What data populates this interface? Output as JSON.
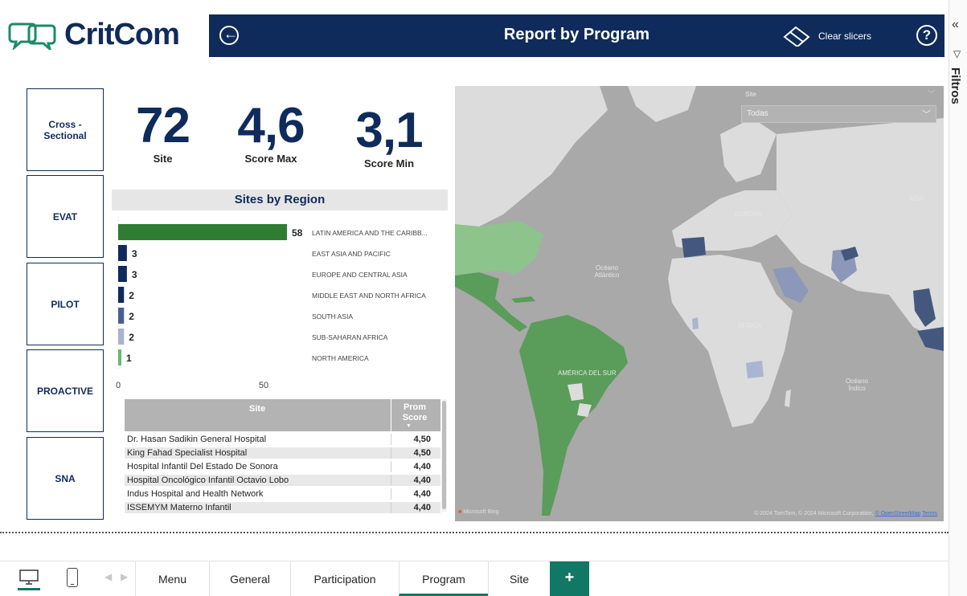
{
  "header": {
    "logo_text": "CritCom",
    "title": "Report by Program",
    "clear_slicers_label": "Clear slicers",
    "help_label": "?"
  },
  "filters_pane": {
    "label": "Filtros",
    "collapse_icon": "double-chevron-left-icon",
    "filter_icon": "funnel-icon"
  },
  "nav": {
    "buttons": [
      "Cross -\nSectional",
      "EVAT",
      "PILOT",
      "PROACTIVE",
      "SNA"
    ]
  },
  "kpis": [
    {
      "value": "72",
      "label": "Site"
    },
    {
      "value": "4,6",
      "label": "Score Max"
    },
    {
      "value": "3,1",
      "label": "Score Min"
    }
  ],
  "sites_by_region": {
    "title": "Sites by Region"
  },
  "chart_data": {
    "type": "bar",
    "orientation": "horizontal",
    "title": "Sites by Region",
    "categories": [
      "LATIN AMERICA AND THE CARIBB...",
      "EAST ASIA AND PACIFIC",
      "EUROPE AND CENTRAL ASIA",
      "MIDDLE EAST AND NORTH AFRICA",
      "SOUTH ASIA",
      "SUB-SAHARAN AFRICA",
      "NORTH AMERICA"
    ],
    "values": [
      58,
      3,
      3,
      2,
      2,
      2,
      1
    ],
    "colors": [
      "#2e7d32",
      "#0f2b5b",
      "#0f2b5b",
      "#0f2b5b",
      "#4b5f8f",
      "#a7b3cf",
      "#66bb6a"
    ],
    "xlim": [
      0,
      58
    ],
    "xticks": [
      "0",
      "50"
    ],
    "grid": false
  },
  "site_table": {
    "columns": [
      "Site",
      "Prom Score"
    ],
    "rows": [
      {
        "site": "Dr. Hasan Sadikin General Hospital",
        "score": "4,50"
      },
      {
        "site": "King Fahad Specialist Hospital",
        "score": "4,50"
      },
      {
        "site": "Hospital Infantil Del Estado De Sonora",
        "score": "4,40"
      },
      {
        "site": "Hospital Oncológico Infantil Octavio Lobo",
        "score": "4,40"
      },
      {
        "site": "Indus Hospital and Health Network",
        "score": "4,40"
      },
      {
        "site": "ISSEMYM Materno Infantil",
        "score": "4,40"
      }
    ]
  },
  "map": {
    "slicer_title": "Site",
    "slicer_value": "Todas",
    "labels": {
      "europa": "EUROPA",
      "asia": "ASIA",
      "africa": "ÁFRICA",
      "atlantic": "Océano Atlántico",
      "indian": "Océano Índico",
      "south_america": "AMÉRICA DEL SUR"
    },
    "bing": "Microsoft Bing",
    "attribution": "© 2024 TomTom, © 2024 Microsoft Corporation,",
    "osm_link": "© OpenStreetMap",
    "terms_link": "Terms",
    "colors": {
      "land": "#dcdcdc",
      "water": "#a9a9a9",
      "latam": "#5a9c5a",
      "north_america": "#8cc48c",
      "dark_blue": "#44587f",
      "mid_blue": "#8b98ba",
      "light_blue": "#a9b5d1"
    }
  },
  "tabs": {
    "pages": [
      "Menu",
      "General",
      "Participation",
      "Program",
      "Site"
    ],
    "active": "Program",
    "add_label": "+"
  }
}
